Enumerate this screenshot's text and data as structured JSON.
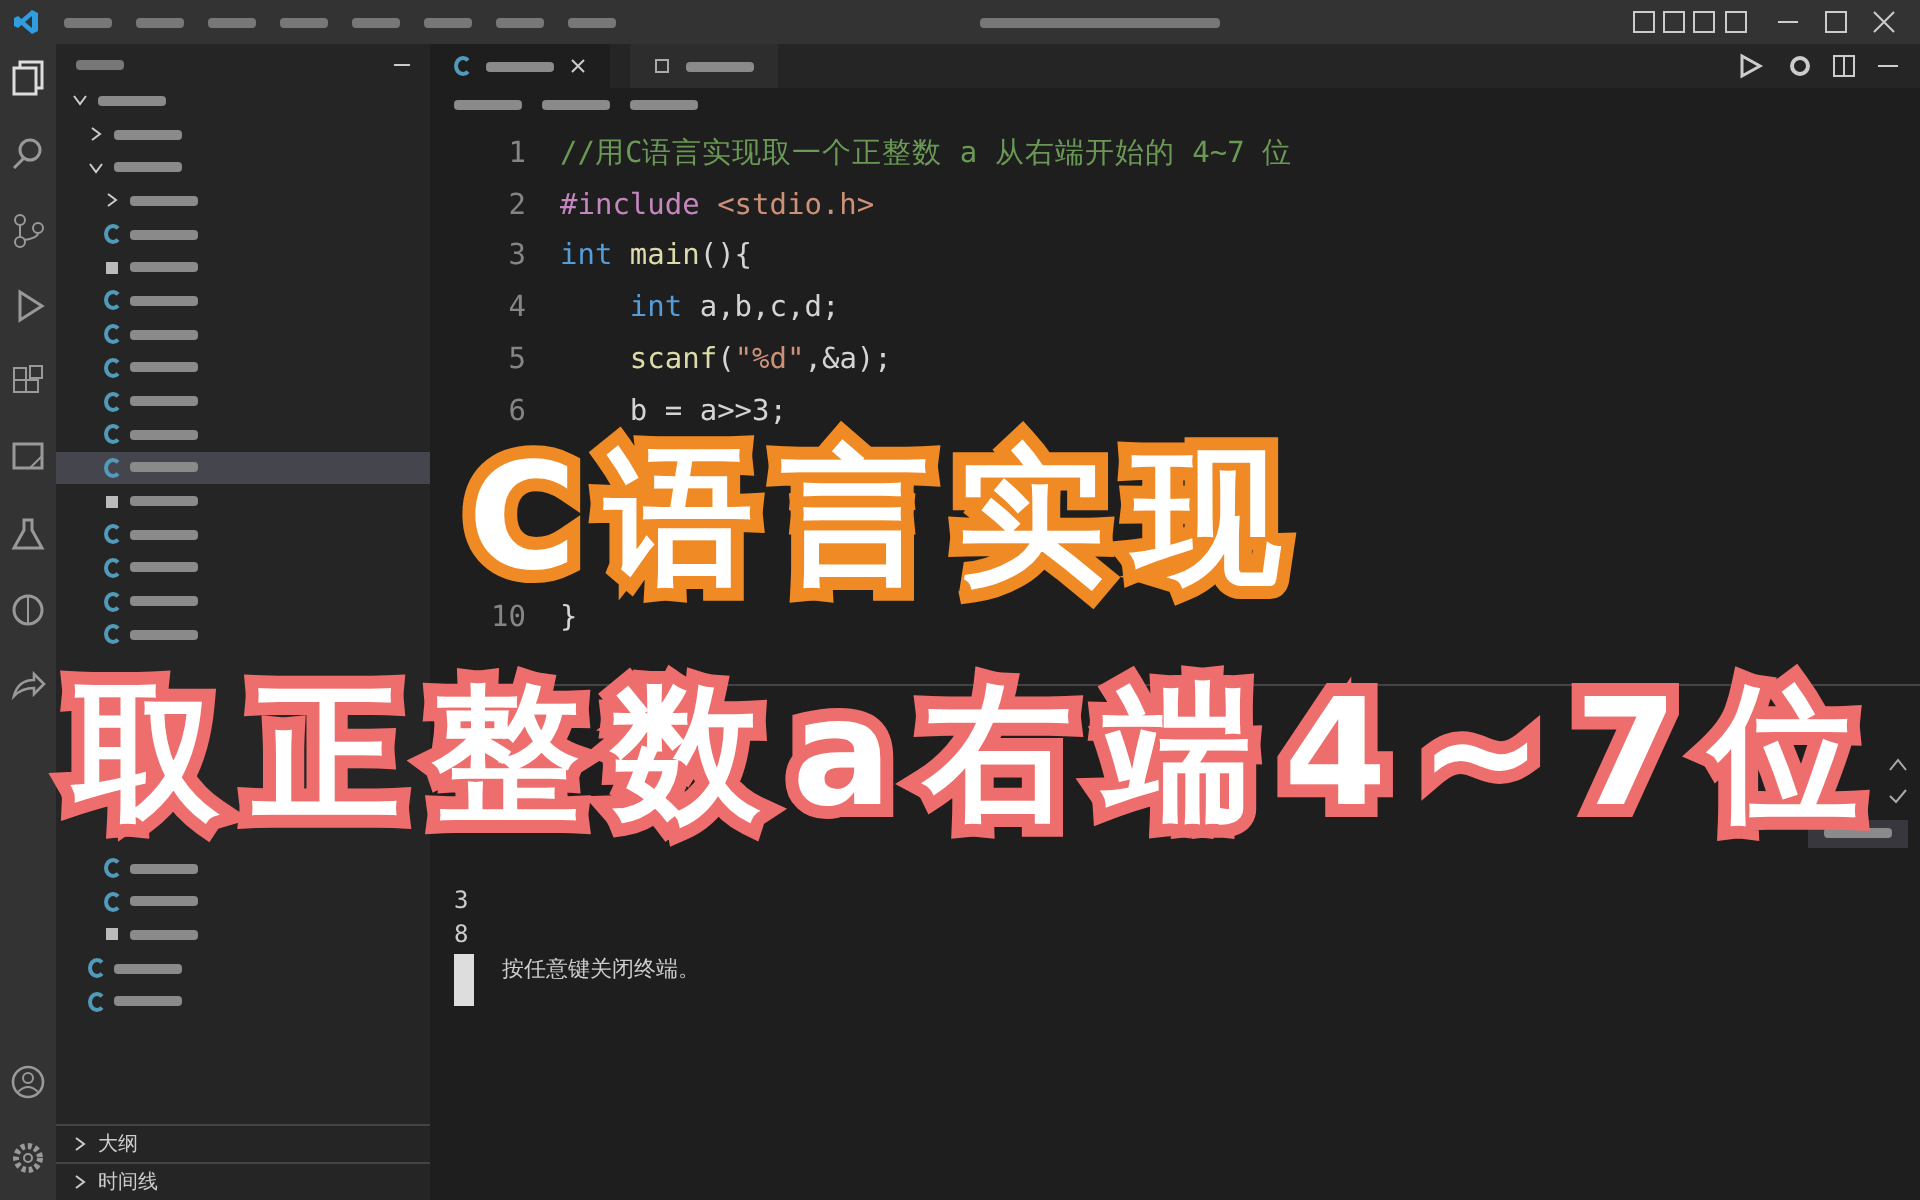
{
  "explorer": {
    "items": [
      {
        "kind": "folder",
        "expanded": true,
        "selected": false,
        "children": [
          {
            "kind": "folder",
            "expanded": false,
            "selected": false
          },
          {
            "kind": "folder",
            "expanded": true,
            "selected": false,
            "children": [
              {
                "kind": "folder",
                "expanded": false,
                "selected": false
              },
              {
                "kind": "c",
                "selected": false
              },
              {
                "kind": "exe",
                "selected": false
              },
              {
                "kind": "c",
                "selected": false
              },
              {
                "kind": "c",
                "selected": false
              },
              {
                "kind": "c",
                "selected": false
              },
              {
                "kind": "c",
                "selected": false
              },
              {
                "kind": "c",
                "selected": false
              },
              {
                "kind": "c",
                "selected": true
              },
              {
                "kind": "exe",
                "selected": false
              },
              {
                "kind": "c",
                "selected": false
              },
              {
                "kind": "c",
                "selected": false
              },
              {
                "kind": "c",
                "selected": false
              },
              {
                "kind": "c",
                "selected": false
              },
              {
                "kind": "c",
                "selected": false
              },
              {
                "kind": "c",
                "selected": false
              },
              {
                "kind": "exe",
                "selected": false
              }
            ]
          },
          {
            "kind": "c",
            "selected": false
          },
          {
            "kind": "c",
            "selected": false
          }
        ]
      }
    ],
    "sections": [
      {
        "label": "大纲"
      },
      {
        "label": "时间线"
      }
    ]
  },
  "editor": {
    "tabs": [
      {
        "kind": "c",
        "selected": true
      },
      {
        "kind": "other",
        "selected": false
      }
    ],
    "lines": [
      {
        "number": "1",
        "tokens": [
          {
            "kind": "comment",
            "text": "//用C语言实现取一个正整数 a 从右端开始的 4~7 位"
          }
        ]
      },
      {
        "number": "2",
        "tokens": [
          {
            "kind": "directive",
            "text": "#include "
          },
          {
            "kind": "string",
            "text": "<stdio.h>"
          }
        ]
      },
      {
        "number": "3",
        "tokens": [
          {
            "kind": "keyword",
            "text": "int "
          },
          {
            "kind": "function",
            "text": "main"
          },
          {
            "kind": "plain",
            "text": "(){"
          }
        ]
      },
      {
        "number": "4",
        "tokens": [
          {
            "kind": "keyword",
            "text": "    int "
          },
          {
            "kind": "plain",
            "text": "a,b,c,d;"
          }
        ]
      },
      {
        "number": "5",
        "tokens": [
          {
            "kind": "function",
            "text": "    scanf"
          },
          {
            "kind": "plain",
            "text": "("
          },
          {
            "kind": "string",
            "text": "\"%d\""
          },
          {
            "kind": "plain",
            "text": ",&a);"
          }
        ]
      },
      {
        "number": "6",
        "tokens": [
          {
            "kind": "plain",
            "text": "    b = a>>3;"
          }
        ]
      },
      {
        "number": "10",
        "tokens": [
          {
            "kind": "plain",
            "text": "}"
          }
        ]
      }
    ]
  },
  "terminal": {
    "output": [
      "3",
      "8"
    ],
    "prompt": "按任意键关闭终端。"
  },
  "overlay": {
    "line_1": "C语言实现",
    "line_2": "取正整数a右端4~7位"
  }
}
